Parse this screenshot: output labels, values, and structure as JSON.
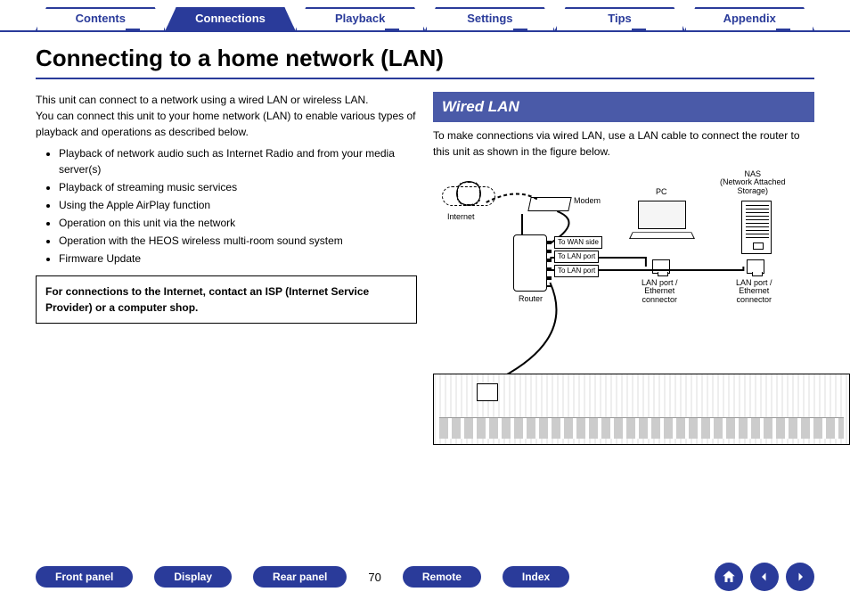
{
  "topnav": {
    "tabs": [
      "Contents",
      "Connections",
      "Playback",
      "Settings",
      "Tips",
      "Appendix"
    ],
    "active_index": 1
  },
  "title": "Connecting to a home network (LAN)",
  "left": {
    "intro1": "This unit can connect to a network using a wired LAN or wireless LAN.",
    "intro2": "You can connect this unit to your home network (LAN) to enable various types of playback and operations as described below.",
    "bullets": [
      "Playback of network audio such as Internet Radio and from your media server(s)",
      "Playback of streaming music services",
      "Using the Apple AirPlay function",
      "Operation on this unit via the network",
      "Operation with the HEOS wireless multi-room sound system",
      "Firmware Update"
    ],
    "note": "For connections to the Internet, contact an ISP (Internet Service Provider) or a computer shop."
  },
  "right": {
    "heading": "Wired LAN",
    "intro": "To make connections via wired LAN, use a LAN cable to connect the router to this unit as shown in the figure below.",
    "diagram": {
      "internet": "Internet",
      "modem": "Modem",
      "router": "Router",
      "pc": "PC",
      "nas": "NAS\n(Network Attached\nStorage)",
      "to_wan": "To WAN side",
      "to_lan": "To LAN port",
      "eth_conn": "LAN port /\nEthernet\nconnector"
    }
  },
  "bottomnav": {
    "buttons": [
      "Front panel",
      "Display",
      "Rear panel",
      "Remote",
      "Index"
    ],
    "page_number": "70"
  }
}
